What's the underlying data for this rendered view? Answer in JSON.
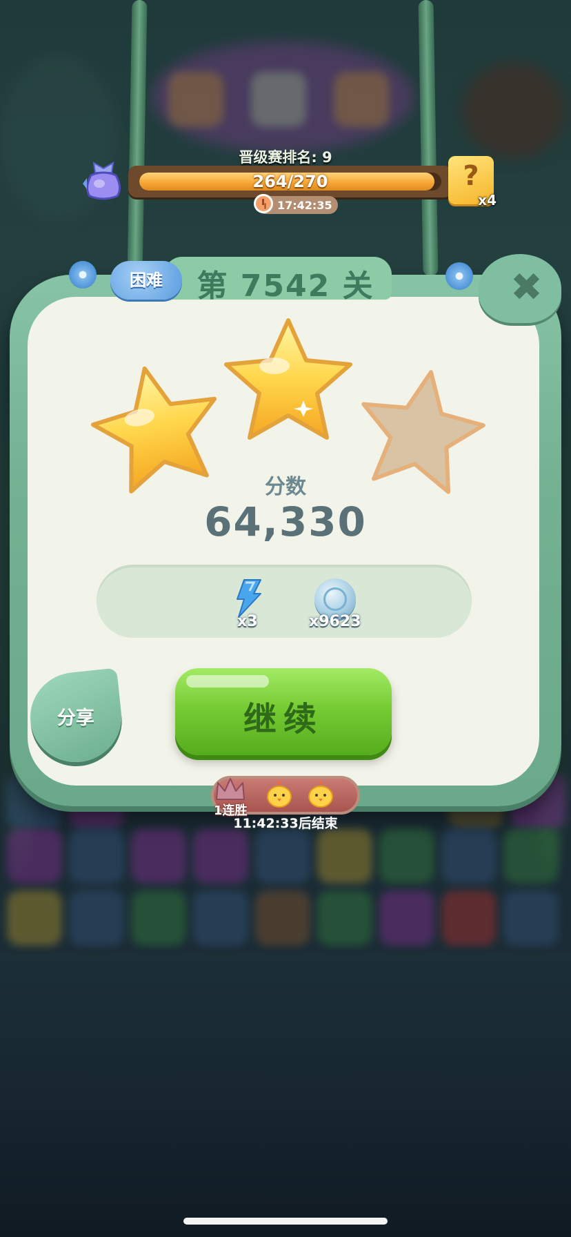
{
  "event": {
    "rank_label": "晋级赛排名: 9",
    "progress_text": "264/270",
    "progress_value": 264,
    "progress_max": 270,
    "timer": "17:42:35",
    "puzzle_count": "x4",
    "puzzle_symbol": "?"
  },
  "dialog": {
    "difficulty": "困难",
    "title": "第 7542 关",
    "close_symbol": "✖",
    "stars_earned": 2,
    "stars_total": 3,
    "score_label": "分数",
    "score_value": "64,330",
    "rewards": [
      {
        "icon": "lightning-bolt-icon",
        "count": "x3"
      },
      {
        "icon": "leaf-coin-icon",
        "count": "x9623"
      }
    ],
    "share_label": "分享",
    "continue_label": "继续"
  },
  "streak": {
    "label": "1连胜",
    "countdown": "11:42:33后结束"
  },
  "colors": {
    "panel_green": "#7fbea0",
    "continue_green": "#76cc34",
    "star_gold": "#f8c93a",
    "star_empty": "#d8c3a4",
    "progress_orange": "#f6a838"
  }
}
